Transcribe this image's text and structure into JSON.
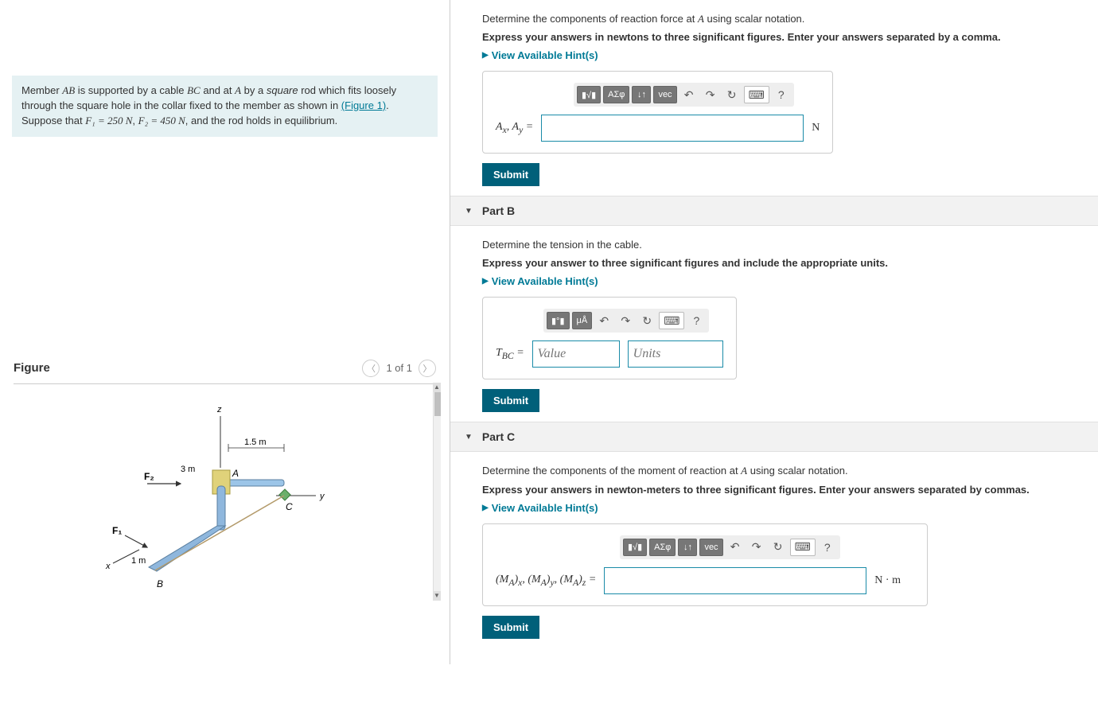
{
  "problem": {
    "text_parts": {
      "p1": "Member ",
      "AB": "AB",
      "p2": " is supported by a cable ",
      "BC": "BC",
      "p3": " and at ",
      "A": "A",
      "p4": " by a ",
      "square": "square",
      "p5": " rod which fits loosely through the square hole in the collar fixed to the member as shown in ",
      "fig_link": "(Figure 1)",
      "p6": ". Suppose that ",
      "F1eq": "F₁ = 250 N",
      "p7": ", ",
      "F2eq": "F₂ = 450 N",
      "p8": ", and the rod holds in equilibrium."
    }
  },
  "figure": {
    "title": "Figure",
    "pager": "1 of 1",
    "labels": {
      "z": "z",
      "y": "y",
      "x": "x",
      "A": "A",
      "B": "B",
      "C": "C",
      "F1": "F₁",
      "F2": "F₂",
      "d15": "1.5 m",
      "d3": "3 m",
      "d1": "1 m"
    }
  },
  "partA": {
    "q": "Determine the components of reaction force at ",
    "q_A": "A",
    "q2": " using scalar notation.",
    "instr": "Express your answers in newtons to three significant figures. Enter your answers separated by a comma.",
    "hints": "View Available Hint(s)",
    "label_html": "Aₓ, Aᵧ =",
    "unit": "N",
    "submit": "Submit",
    "tools": {
      "t1": "▮√▮",
      "t2": "ΑΣφ",
      "t3": "↓↑",
      "t4": "vec",
      "undo": "↶",
      "redo": "↷",
      "reset": "↻",
      "kb": "⌨",
      "help": "?"
    }
  },
  "partB": {
    "title": "Part B",
    "q": "Determine the tension in the cable.",
    "instr": "Express your answer to three significant figures and include the appropriate units.",
    "hints": "View Available Hint(s)",
    "label": "T_BC =",
    "value_ph": "Value",
    "units_ph": "Units",
    "submit": "Submit",
    "tools": {
      "t1": "▮°▮",
      "t2": "μÅ",
      "undo": "↶",
      "redo": "↷",
      "reset": "↻",
      "kb": "⌨",
      "help": "?"
    }
  },
  "partC": {
    "title": "Part C",
    "q": "Determine the components of the moment of reaction at ",
    "q_A": "A",
    "q2": " using scalar notation.",
    "instr": "Express your answers in newton-meters to three significant figures. Enter your answers separated by commas.",
    "hints": "View Available Hint(s)",
    "label": "(M_A)ₓ, (M_A)ᵧ, (M_A)_z =",
    "unit": "N · m",
    "submit": "Submit",
    "tools": {
      "t1": "▮√▮",
      "t2": "ΑΣφ",
      "t3": "↓↑",
      "t4": "vec",
      "undo": "↶",
      "redo": "↷",
      "reset": "↻",
      "kb": "⌨",
      "help": "?"
    }
  }
}
